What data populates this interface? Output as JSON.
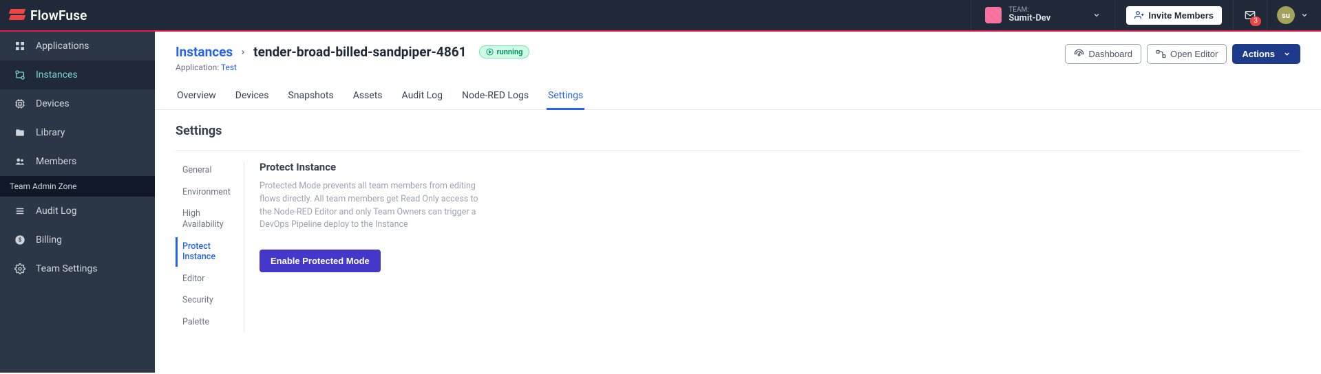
{
  "brand": "FlowFuse",
  "team": {
    "label": "TEAM:",
    "name": "Sumit-Dev"
  },
  "invite_label": "Invite Members",
  "notification_count": "3",
  "avatar_initials": "su",
  "sidebar": {
    "items": [
      {
        "label": "Applications"
      },
      {
        "label": "Instances"
      },
      {
        "label": "Devices"
      },
      {
        "label": "Library"
      },
      {
        "label": "Members"
      }
    ],
    "admin_header": "Team Admin Zone",
    "admin_items": [
      {
        "label": "Audit Log"
      },
      {
        "label": "Billing"
      },
      {
        "label": "Team Settings"
      }
    ]
  },
  "breadcrumb": {
    "root": "Instances",
    "current": "tender-broad-billed-sandpiper-4861"
  },
  "status": "running",
  "application": {
    "label": "Application:",
    "name": "Test"
  },
  "actions": {
    "dashboard": "Dashboard",
    "open_editor": "Open Editor",
    "actions": "Actions"
  },
  "tabs": [
    "Overview",
    "Devices",
    "Snapshots",
    "Assets",
    "Audit Log",
    "Node-RED Logs",
    "Settings"
  ],
  "active_tab": "Settings",
  "settings": {
    "title": "Settings",
    "side": [
      "General",
      "Environment",
      "High Availability",
      "Protect Instance",
      "Editor",
      "Security",
      "Palette"
    ],
    "active_side": "Protect Instance",
    "content": {
      "title": "Protect Instance",
      "desc": "Protected Mode prevents all team members from editing flows directly. All team members get Read Only access to the Node-RED Editor and only Team Owners can trigger a DevOps Pipeline deploy to the Instance",
      "button": "Enable Protected Mode"
    }
  }
}
